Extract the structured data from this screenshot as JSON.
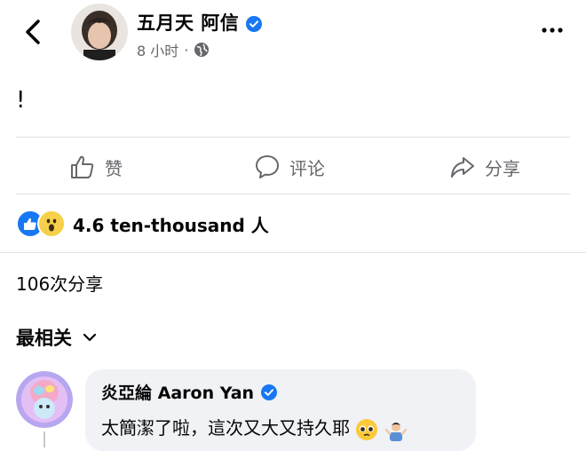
{
  "header": {
    "author": "五月天 阿信",
    "time": "8 小时",
    "separator": "·"
  },
  "post": {
    "text": "!"
  },
  "actions": {
    "like_label": "赞",
    "comment_label": "评论",
    "share_label": "分享"
  },
  "reactions": {
    "count_text": "4.6 ten-thousand 人",
    "types": [
      "like",
      "wow"
    ]
  },
  "shares": {
    "text": "106次分享"
  },
  "sort": {
    "label": "最相关"
  },
  "comment": {
    "author": "炎亞綸 Aaron Yan",
    "text": "太簡潔了啦，這次又大又持久耶",
    "emojis": [
      "pleading-face-emoji",
      "person-shrugging-emoji"
    ]
  },
  "colors": {
    "verified_blue": "#1877f2",
    "secondary_text": "#65676b",
    "bubble_bg": "#f0f2f5",
    "divider": "#dfe1e5"
  }
}
